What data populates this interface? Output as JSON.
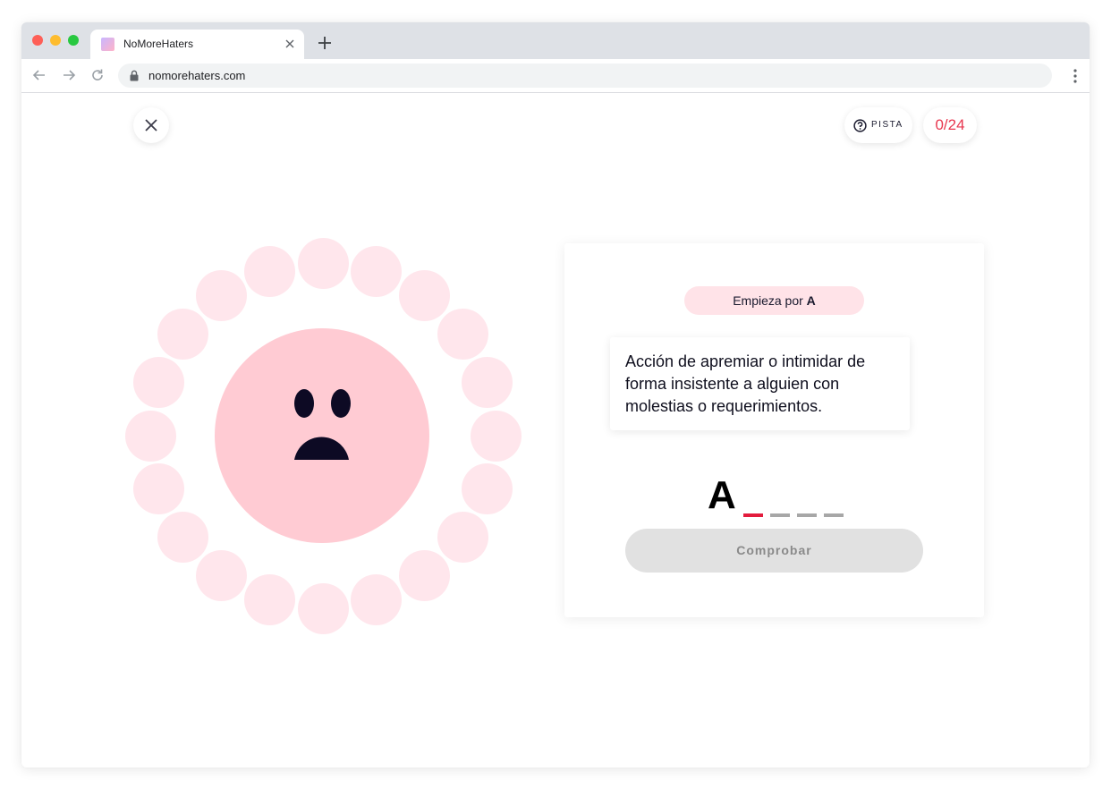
{
  "browser": {
    "tab_title": "NoMoreHaters",
    "url": "nomorehaters.com"
  },
  "game": {
    "close_icon": "close-icon",
    "hint": {
      "icon": "question-circle-icon",
      "label": "PISTA"
    },
    "score": "0/24",
    "face": "sad-face",
    "letters_total": 20
  },
  "card": {
    "prefix_label": "Empieza por",
    "prefix_letter": "A",
    "definition": "Acción de apremiar o intimidar de forma insistente a alguien con molestias o requerimientos.",
    "answer_letter": "A",
    "answer_slots": 4,
    "check_button": "Comprobar"
  },
  "colors": {
    "accent": "#e8374f",
    "bubble": "#ffe6ec",
    "face": "#ffcbd3",
    "button_disabled": "#e1e1e1"
  }
}
